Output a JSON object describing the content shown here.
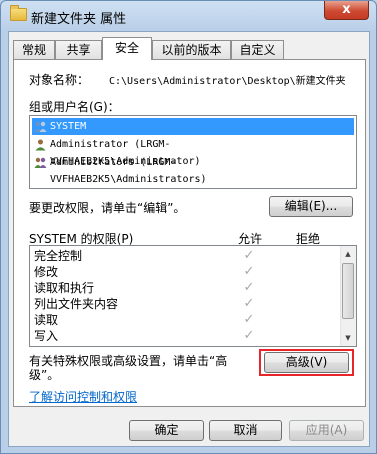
{
  "window": {
    "title": "新建文件夹 属性",
    "close_label": "x"
  },
  "tabs": [
    {
      "label": "常规"
    },
    {
      "label": "共享"
    },
    {
      "label": "安全"
    },
    {
      "label": "以前的版本"
    },
    {
      "label": "自定义"
    }
  ],
  "security": {
    "object_name_label": "对象名称：",
    "object_name_value": "C:\\Users\\Administrator\\Desktop\\新建文件夹",
    "groups_label": "组或用户名(G)：",
    "groups": [
      {
        "name": "SYSTEM",
        "icon": "users-group-icon",
        "selected": true
      },
      {
        "name": "Administrator (LRGM-VVFHAEB2K5\\Administrator)",
        "icon": "user-icon",
        "selected": false
      },
      {
        "name": "Administrators (LRGM-VVFHAEB2K5\\Administrators)",
        "icon": "users-group-icon",
        "selected": false
      }
    ],
    "edit_hint": "要更改权限，请单击“编辑”。",
    "edit_button": "编辑(E)...",
    "permissions_label": "SYSTEM 的权限(P)",
    "allow_header": "允许",
    "deny_header": "拒绝",
    "permissions": [
      {
        "name": "完全控制",
        "allow": "✓",
        "deny": ""
      },
      {
        "name": "修改",
        "allow": "✓",
        "deny": ""
      },
      {
        "name": "读取和执行",
        "allow": "✓",
        "deny": ""
      },
      {
        "name": "列出文件夹内容",
        "allow": "✓",
        "deny": ""
      },
      {
        "name": "读取",
        "allow": "✓",
        "deny": ""
      },
      {
        "name": "写入",
        "allow": "✓",
        "deny": ""
      }
    ],
    "advanced_hint_line1": "有关特殊权限或高级设置，请单击“高",
    "advanced_hint_line2": "级”。",
    "advanced_button": "高级(V)",
    "learn_link": "了解访问控制和权限"
  },
  "footer": {
    "ok": "确定",
    "cancel": "取消",
    "apply": "应用(A)"
  },
  "colors": {
    "selection": "#3399ff",
    "highlight_box": "#e8262a",
    "link": "#0066cc"
  }
}
